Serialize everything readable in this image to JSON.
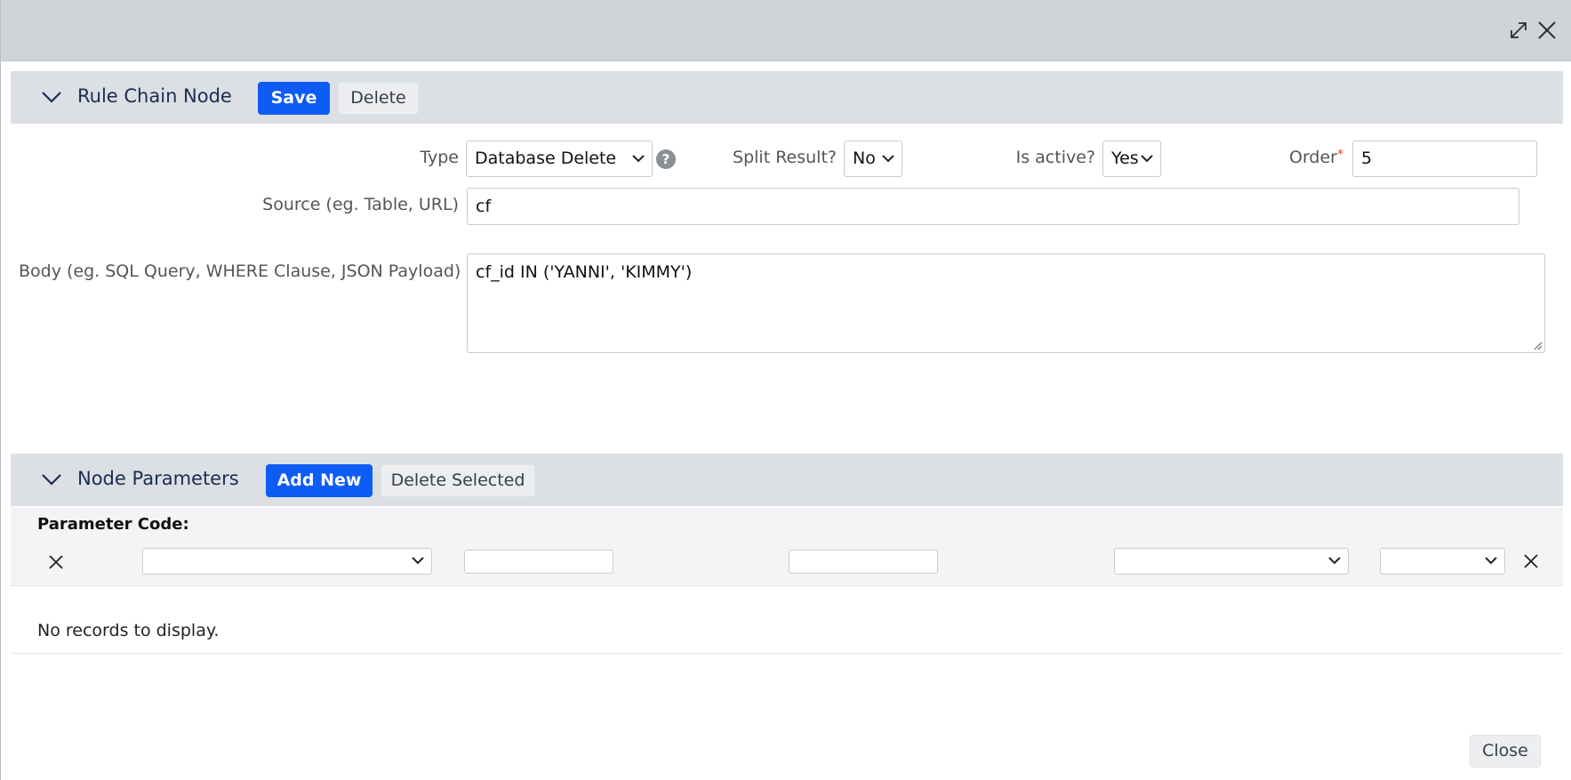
{
  "window": {
    "icons": [
      "expand-icon",
      "close-icon"
    ]
  },
  "rule_chain_node": {
    "title": "Rule Chain Node",
    "save_label": "Save",
    "delete_label": "Delete",
    "type_label": "Type",
    "type_value": "Database Delete",
    "split_result_label": "Split Result?",
    "split_result_value": "No",
    "is_active_label": "Is active?",
    "is_active_value": "Yes",
    "order_label": "Order",
    "order_required": "*",
    "order_value": "5",
    "source_label": "Source (eg. Table, URL)",
    "source_value": "cf",
    "body_label": "Body (eg. SQL Query, WHERE Clause, JSON Payload)",
    "body_value": "cf_id IN ('YANNI', 'KIMMY')"
  },
  "node_parameters": {
    "title": "Node Parameters",
    "add_new_label": "Add New",
    "delete_selected_label": "Delete Selected",
    "parameter_code_label": "Parameter Code:",
    "empty_message": "No records to display."
  },
  "footer": {
    "close_label": "Close"
  },
  "colors": {
    "primary": "#0d5cf5",
    "titlebar": "#cfd4d9",
    "section_header": "#dcdfe3",
    "section_title": "#1b2d52"
  }
}
